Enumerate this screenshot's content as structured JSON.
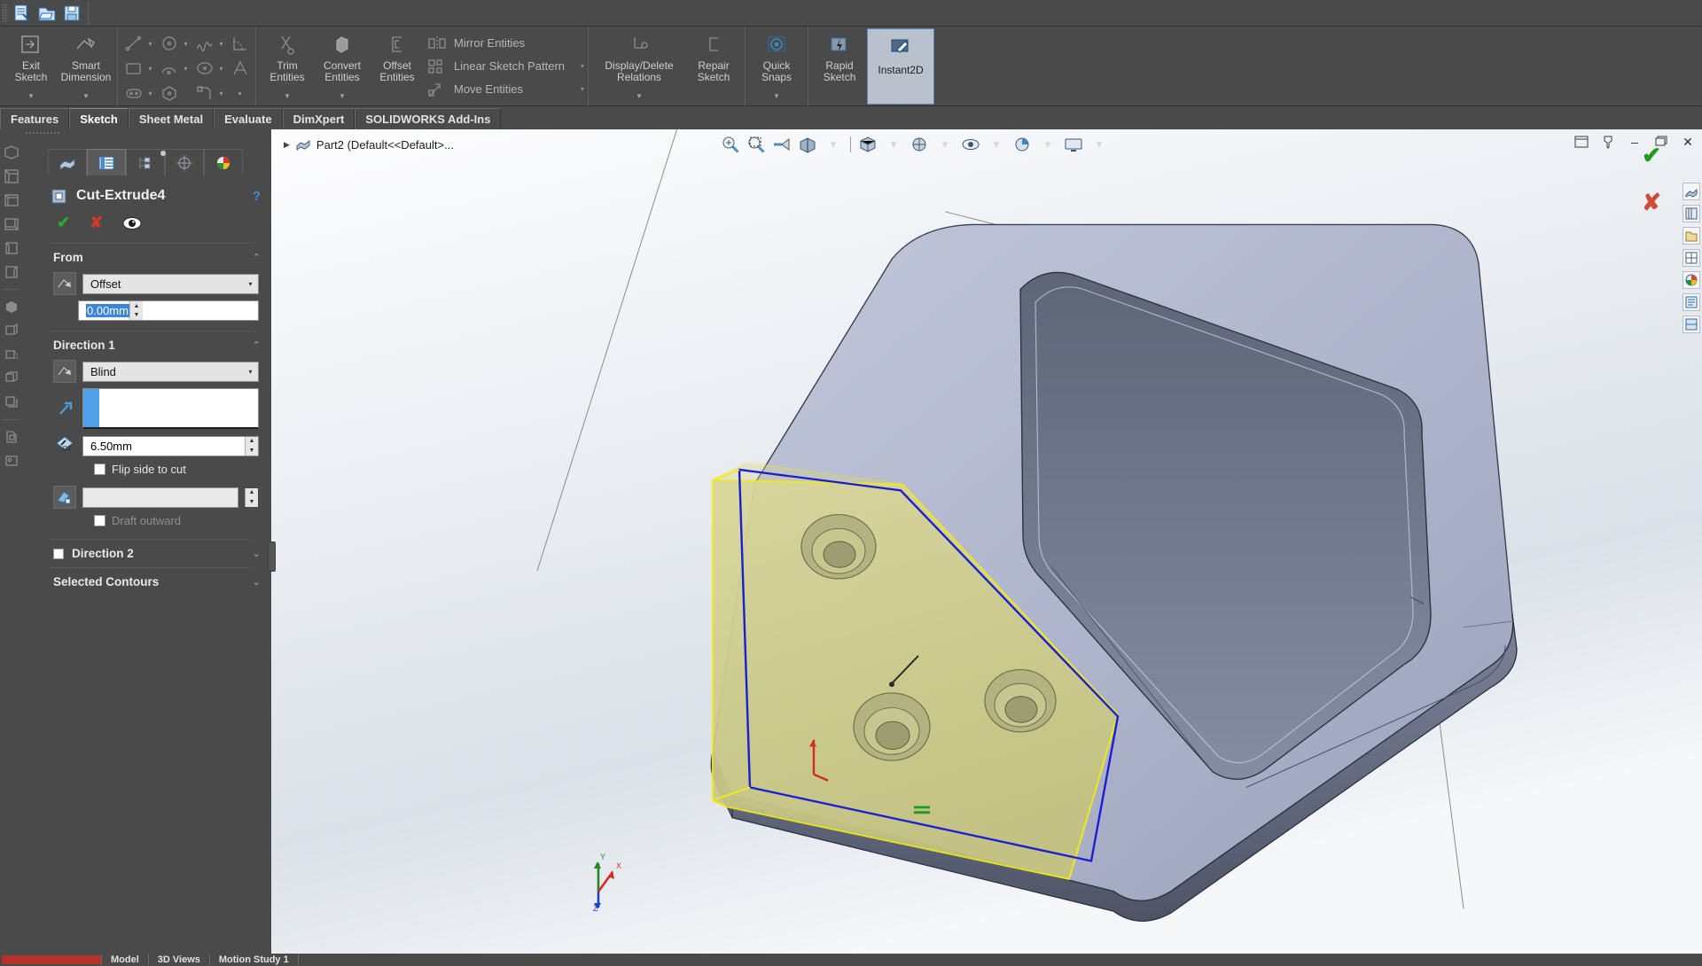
{
  "app": {
    "title": "SOLIDWORKS",
    "document": "Part2"
  },
  "quick_access": {
    "icons": [
      "new-document-icon",
      "open-document-icon",
      "save-document-icon"
    ]
  },
  "ribbon": {
    "groups": [
      {
        "name": "sketch-main",
        "buttons": [
          {
            "label": "Exit\nSketch",
            "label_line1": "Exit",
            "label_line2": "Sketch",
            "icon": "exit-sketch-icon",
            "has_caret": true,
            "selected": false
          },
          {
            "label_line1": "Smart",
            "label_line2": "Dimension",
            "icon": "smart-dimension-icon",
            "has_caret": true,
            "selected": false
          }
        ]
      },
      {
        "name": "sketch-entities",
        "tools": [
          {
            "icon": "line-icon",
            "dropdown": true
          },
          {
            "icon": "circle-icon",
            "dropdown": true
          },
          {
            "icon": "spline-icon",
            "dropdown": true
          },
          {
            "icon": "fillet-icon",
            "dropdown": false
          },
          {
            "icon": "rectangle-icon",
            "dropdown": true
          },
          {
            "icon": "arc-icon",
            "dropdown": true
          },
          {
            "icon": "ellipse-icon",
            "dropdown": true
          },
          {
            "icon": "text-icon",
            "dropdown": false
          },
          {
            "icon": "slot-icon",
            "dropdown": true
          },
          {
            "icon": "polygon-icon",
            "dropdown": false
          },
          {
            "icon": "sketch-fillet-icon",
            "dropdown": true
          },
          {
            "icon": "point-icon",
            "dropdown": false
          }
        ]
      },
      {
        "name": "sketch-edit",
        "buttons": [
          {
            "label_line1": "Trim",
            "label_line2": "Entities",
            "icon": "trim-entities-icon",
            "has_caret": true
          },
          {
            "label_line1": "Convert",
            "label_line2": "Entities",
            "icon": "convert-entities-icon",
            "has_caret": true
          },
          {
            "label_line1": "Offset",
            "label_line2": "Entities",
            "icon": "offset-entities-icon",
            "has_caret": false
          }
        ],
        "list_items": [
          {
            "label": "Mirror Entities",
            "icon": "mirror-entities-icon",
            "dropdown": false
          },
          {
            "label": "Linear Sketch Pattern",
            "icon": "linear-sketch-pattern-icon",
            "dropdown": true
          },
          {
            "label": "Move Entities",
            "icon": "move-entities-icon",
            "dropdown": true
          }
        ]
      },
      {
        "name": "sketch-relations",
        "buttons": [
          {
            "label_line1": "Display/Delete",
            "label_line2": "Relations",
            "icon": "display-delete-relations-icon",
            "has_caret": true
          },
          {
            "label_line1": "Repair",
            "label_line2": "Sketch",
            "icon": "repair-sketch-icon",
            "has_caret": false
          }
        ]
      },
      {
        "name": "sketch-snaps",
        "buttons": [
          {
            "label_line1": "Quick",
            "label_line2": "Snaps",
            "icon": "quick-snaps-icon",
            "has_caret": true
          }
        ]
      },
      {
        "name": "sketch-modes",
        "buttons": [
          {
            "label_line1": "Rapid",
            "label_line2": "Sketch",
            "icon": "rapid-sketch-icon",
            "has_caret": false,
            "selected": false
          },
          {
            "label_line1": "Instant2D",
            "label_line2": "",
            "icon": "instant2d-icon",
            "has_caret": false,
            "selected": true
          }
        ]
      }
    ]
  },
  "tabs": [
    {
      "label": "Features",
      "active": false
    },
    {
      "label": "Sketch",
      "active": true
    },
    {
      "label": "Sheet Metal",
      "active": false
    },
    {
      "label": "Evaluate",
      "active": false
    },
    {
      "label": "DimXpert",
      "active": false
    },
    {
      "label": "SOLIDWORKS Add-Ins",
      "active": false
    }
  ],
  "left_rail": {
    "icons": [
      "view-orientation-icon",
      "isometric-view-icon",
      "front-view-icon",
      "back-view-icon",
      "left-view-icon",
      "right-view-icon",
      "top-view-icon",
      "bottom-view-icon",
      "section-view-icon",
      "display-style-icon",
      "hidden-lines-visible-icon",
      "wireframe-icon",
      "shadows-icon",
      "appearance-icon",
      "scene-icon"
    ]
  },
  "property_manager": {
    "tabs": [
      {
        "icon": "feature-manager-icon",
        "active": false
      },
      {
        "icon": "property-manager-icon",
        "active": true
      },
      {
        "icon": "configuration-manager-icon",
        "active": false
      },
      {
        "icon": "dimxpert-manager-icon",
        "active": false
      },
      {
        "icon": "display-manager-icon",
        "active": false
      }
    ],
    "feature_icon": "cut-extrude-icon",
    "feature_name": "Cut-Extrude4",
    "help_icon": "help-icon",
    "actions": [
      {
        "name": "ok-button",
        "glyph": "✔",
        "label": "OK"
      },
      {
        "name": "cancel-button",
        "glyph": "✘",
        "label": "Cancel"
      },
      {
        "name": "preview-button",
        "glyph": "◉",
        "label": "Detailed Preview"
      }
    ],
    "sections": [
      {
        "id": "from",
        "title": "From",
        "collapse_glyph": "⌃",
        "start_condition": {
          "icon": "from-condition-icon",
          "value": "Offset"
        },
        "offset_distance": {
          "value": "0.00mm",
          "selected": true
        }
      },
      {
        "id": "direction1",
        "title": "Direction 1",
        "collapse_glyph": "⌃",
        "end_condition": {
          "icon": "end-condition-icon",
          "value": "Blind"
        },
        "direction_selector": {
          "icon": "reverse-direction-icon",
          "value": ""
        },
        "depth": {
          "icon": "depth-d1-icon",
          "value": "6.50mm"
        },
        "flip_side_to_cut": {
          "label": "Flip side to cut",
          "checked": false
        },
        "draft": {
          "icon": "draft-angle-icon",
          "value": ""
        },
        "draft_outward": {
          "label": "Draft outward",
          "checked": false,
          "disabled": true
        }
      },
      {
        "id": "direction2",
        "title": "Direction 2",
        "checkbox": true,
        "checked": false,
        "collapse_glyph": "⌄"
      },
      {
        "id": "selected_contours",
        "title": "Selected Contours",
        "collapse_glyph": "⌄"
      }
    ]
  },
  "feature_tree": {
    "expand_glyph": "▶",
    "icon": "part-icon",
    "label": "Part2  (Default<<Default>..."
  },
  "view_toolbar": {
    "items": [
      {
        "icon": "zoom-to-fit-icon",
        "dropdown": false
      },
      {
        "icon": "zoom-to-area-icon",
        "dropdown": false
      },
      {
        "icon": "previous-view-icon",
        "dropdown": false
      },
      {
        "icon": "section-view-icon",
        "dropdown": true
      },
      {
        "icon": "view-orientation-icon",
        "dropdown": true
      },
      {
        "icon": "display-style-icon",
        "dropdown": true
      },
      {
        "icon": "hide-show-items-icon",
        "dropdown": true
      },
      {
        "icon": "edit-appearance-icon",
        "dropdown": true
      },
      {
        "icon": "apply-scene-icon",
        "dropdown": true
      },
      {
        "icon": "view-settings-icon",
        "dropdown": true
      }
    ]
  },
  "confirm_corner": {
    "ok_glyph": "✔",
    "cancel_glyph": "✘"
  },
  "window_controls": {
    "restore_tile_icon": "tile-window-icon",
    "pin_icon": "pin-icon",
    "minimize_glyph": "–",
    "maximize_glyph": "❐",
    "close_glyph": "✕"
  },
  "task_pane": {
    "icons": [
      "solidworks-resources-icon",
      "design-library-icon",
      "file-explorer-icon",
      "view-palette-icon",
      "appearances-scenes-icon",
      "custom-properties-icon",
      "dimxpert-icon"
    ]
  },
  "triad": {
    "labels": [
      "Y",
      "X",
      "Z"
    ],
    "x_color": "#d42b1a",
    "y_color": "#1f8a1f",
    "z_color": "#1a45c0"
  },
  "status_bar": {
    "items": [
      {
        "label": "Model",
        "active": true
      },
      {
        "label": "3D Views",
        "active": false
      },
      {
        "label": "Motion Study 1",
        "active": false
      }
    ]
  },
  "model": {
    "description": "Shaded triangular bracket with rounded rectangular window, three counterbored holes on the highlighted yellow sketch face",
    "colors": {
      "body_light": "#b7bcd0",
      "body_mid": "#8e94ab",
      "body_dark": "#5e6475",
      "sketch_face": "#cfce8a",
      "sketch_outline_yellow": "#f2ea1a",
      "sketch_outline_blue": "#1b1fd0",
      "relation_green": "#1f9c1f"
    }
  }
}
